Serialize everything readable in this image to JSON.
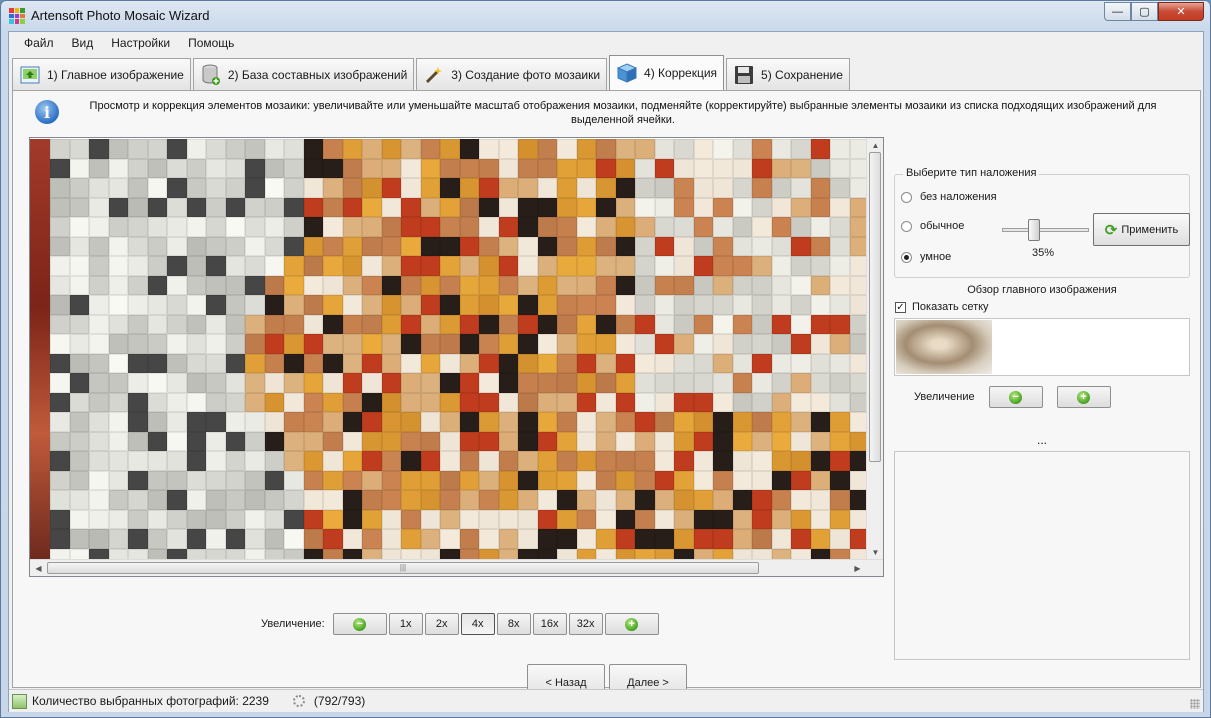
{
  "window": {
    "title": "Artensoft Photo Mosaic Wizard"
  },
  "menu": [
    "Файл",
    "Вид",
    "Настройки",
    "Помощь"
  ],
  "tabs": [
    {
      "label": "1) Главное изображение",
      "icon": "main-image-icon"
    },
    {
      "label": "2) База составных изображений",
      "icon": "database-icon"
    },
    {
      "label": "3) Создание фото мозаики",
      "icon": "magic-wand-icon"
    },
    {
      "label": "4) Коррекция",
      "icon": "cube-icon",
      "active": true
    },
    {
      "label": "5) Сохранение",
      "icon": "floppy-disk-icon"
    }
  ],
  "info": {
    "text": "Просмотр и коррекция элементов мозаики: увеличивайте или уменьшайте масштаб отображения мозаики, подменяйте (корректируйте) выбранные элементы мозаики из списка подходящих изображений для выделенной ячейки."
  },
  "zoom": {
    "label": "Увеличение:",
    "options": [
      "1x",
      "2x",
      "4x",
      "8x",
      "16x",
      "32x"
    ],
    "selected": "4x"
  },
  "overlay": {
    "title": "Выберите тип наложения",
    "options": [
      "без наложения",
      "обычное",
      "умное"
    ],
    "selected": "умное",
    "slider_value": "35%",
    "slider_fraction": 0.35,
    "apply_label": "Применить"
  },
  "overview": {
    "title": "Обзор главного изображения",
    "show_grid_label": "Показать сетку",
    "show_grid": true,
    "zoom_label": "Увеличение",
    "ellipsis": "..."
  },
  "nav": {
    "back": "< Назад",
    "next": "Далее >"
  },
  "status": {
    "selected_photos": "Количество выбранных фотографий: 2239",
    "progress": "(792/793)"
  },
  "colors": {
    "title_bar": "#c9d8ea",
    "accent_green": "#3e9b1c",
    "info_blue": "#2a6fc4"
  }
}
